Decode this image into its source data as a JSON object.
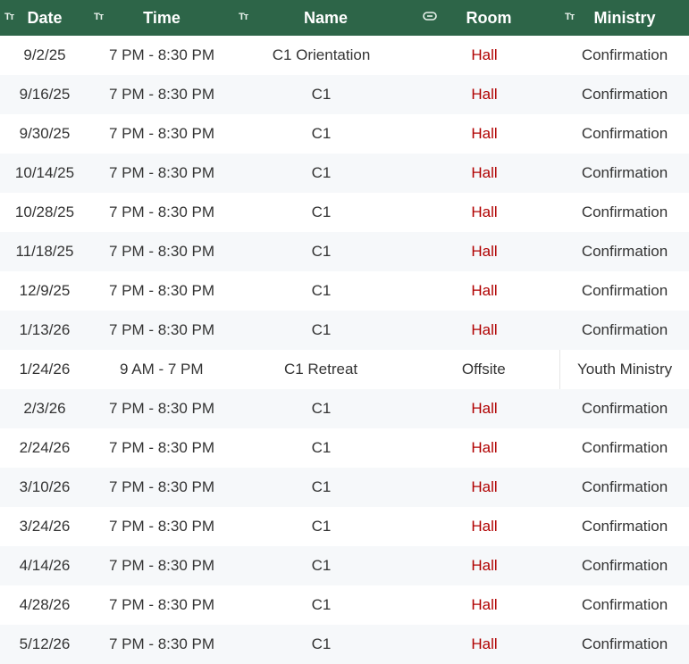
{
  "header": {
    "date": "Date",
    "time": "Time",
    "name": "Name",
    "room": "Room",
    "ministry": "Ministry",
    "text_icon": "Tт"
  },
  "rows": [
    {
      "date": "9/2/25",
      "time": "7 PM - 8:30 PM",
      "name": "C1 Orientation",
      "room": "Hall",
      "ministry": "Confirmation"
    },
    {
      "date": "9/16/25",
      "time": "7 PM - 8:30 PM",
      "name": "C1",
      "room": "Hall",
      "ministry": "Confirmation"
    },
    {
      "date": "9/30/25",
      "time": "7 PM - 8:30 PM",
      "name": "C1",
      "room": "Hall",
      "ministry": "Confirmation"
    },
    {
      "date": "10/14/25",
      "time": "7 PM - 8:30 PM",
      "name": "C1",
      "room": "Hall",
      "ministry": "Confirmation"
    },
    {
      "date": "10/28/25",
      "time": "7 PM - 8:30 PM",
      "name": "C1",
      "room": "Hall",
      "ministry": "Confirmation"
    },
    {
      "date": "11/18/25",
      "time": "7 PM - 8:30 PM",
      "name": "C1",
      "room": "Hall",
      "ministry": "Confirmation"
    },
    {
      "date": "12/9/25",
      "time": "7 PM - 8:30 PM",
      "name": "C1",
      "room": "Hall",
      "ministry": "Confirmation"
    },
    {
      "date": "1/13/26",
      "time": "7 PM - 8:30 PM",
      "name": "C1",
      "room": "Hall",
      "ministry": "Confirmation"
    },
    {
      "date": "1/24/26",
      "time": "9 AM - 7 PM",
      "name": "C1 Retreat",
      "room": "Offsite",
      "ministry": "Youth Ministry"
    },
    {
      "date": "2/3/26",
      "time": "7 PM - 8:30 PM",
      "name": "C1",
      "room": "Hall",
      "ministry": "Confirmation"
    },
    {
      "date": "2/24/26",
      "time": "7 PM - 8:30 PM",
      "name": "C1",
      "room": "Hall",
      "ministry": "Confirmation"
    },
    {
      "date": "3/10/26",
      "time": "7 PM - 8:30 PM",
      "name": "C1",
      "room": "Hall",
      "ministry": "Confirmation"
    },
    {
      "date": "3/24/26",
      "time": "7 PM - 8:30 PM",
      "name": "C1",
      "room": "Hall",
      "ministry": "Confirmation"
    },
    {
      "date": "4/14/26",
      "time": "7 PM - 8:30 PM",
      "name": "C1",
      "room": "Hall",
      "ministry": "Confirmation"
    },
    {
      "date": "4/28/26",
      "time": "7 PM - 8:30 PM",
      "name": "C1",
      "room": "Hall",
      "ministry": "Confirmation"
    },
    {
      "date": "5/12/26",
      "time": "7 PM - 8:30 PM",
      "name": "C1",
      "room": "Hall",
      "ministry": "Confirmation"
    }
  ],
  "colors": {
    "header_bg": "#2d6548",
    "room_hall": "#b00000",
    "row_alt_bg": "#f6f8fa"
  }
}
